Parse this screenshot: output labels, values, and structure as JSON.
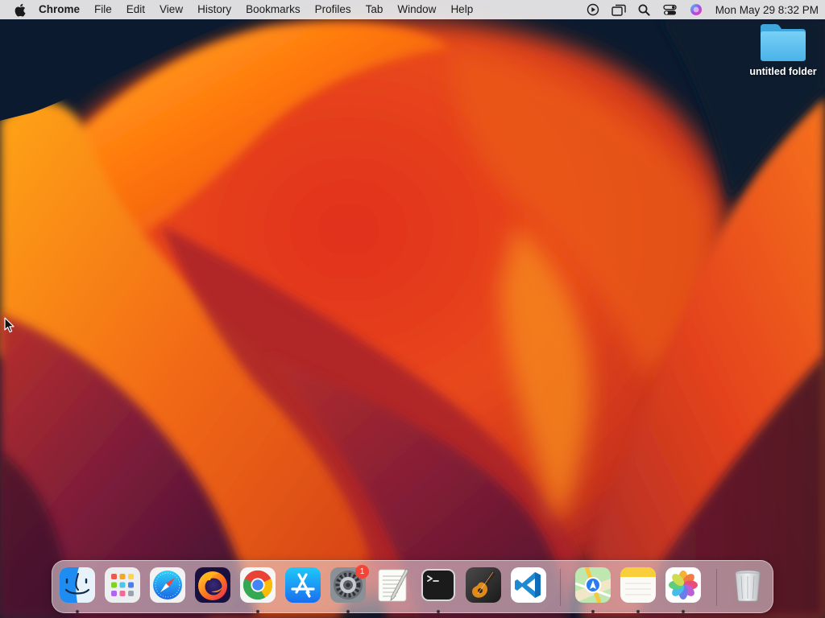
{
  "menubar": {
    "app_name": "Chrome",
    "menus": [
      "File",
      "Edit",
      "View",
      "History",
      "Bookmarks",
      "Profiles",
      "Tab",
      "Window",
      "Help"
    ],
    "clock": "Mon May 29  8:32 PM",
    "status_icons": [
      "play-circle-icon",
      "screen-mirroring-icon",
      "spotlight-search-icon",
      "control-center-icon",
      "siri-icon"
    ]
  },
  "desktop": {
    "folder_label": "untitled folder"
  },
  "dock": {
    "apps": [
      {
        "name": "finder",
        "running": true
      },
      {
        "name": "launchpad",
        "running": false
      },
      {
        "name": "safari",
        "running": false
      },
      {
        "name": "firefox",
        "running": false
      },
      {
        "name": "chrome",
        "running": true
      },
      {
        "name": "app-store",
        "running": false
      },
      {
        "name": "system-settings",
        "running": true,
        "badge": "1"
      },
      {
        "name": "textedit",
        "running": false
      },
      {
        "name": "terminal",
        "running": true
      },
      {
        "name": "garageband",
        "running": false
      },
      {
        "name": "vscode",
        "running": false
      },
      {
        "name": "maps",
        "running": true
      },
      {
        "name": "notes",
        "running": true
      },
      {
        "name": "photos",
        "running": true
      },
      {
        "name": "trash",
        "running": false
      }
    ]
  },
  "colors": {
    "menubar_bg": "#eeecec",
    "folder_blue": "#5ec0f0",
    "badge_red": "#f24537",
    "wallpaper_orange": "#f26a12",
    "wallpaper_dark": "#0b1a2e"
  }
}
